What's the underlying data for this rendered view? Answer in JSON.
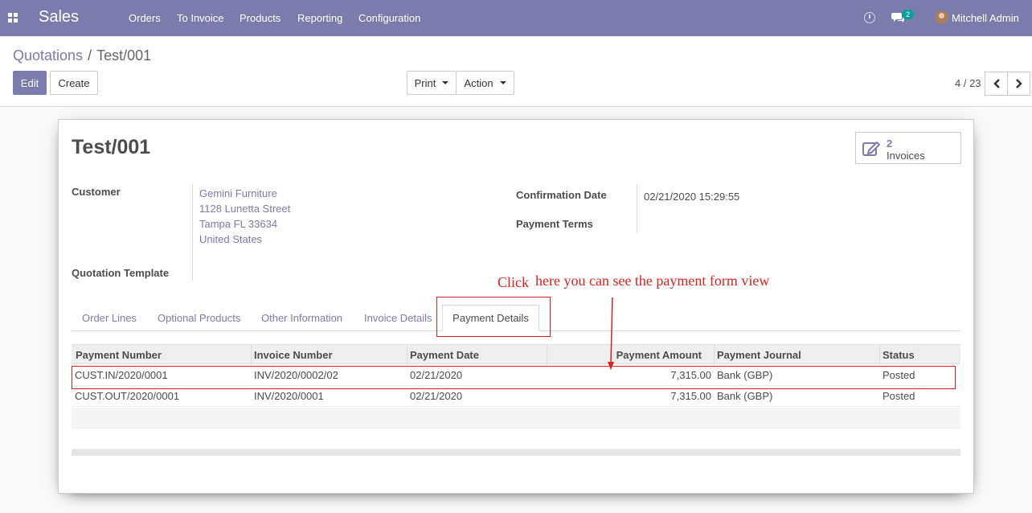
{
  "navbar": {
    "brand": "Sales",
    "menu": [
      "Orders",
      "To Invoice",
      "Products",
      "Reporting",
      "Configuration"
    ],
    "message_count": "2",
    "user": "Mitchell Admin"
  },
  "breadcrumb": {
    "parent": "Quotations",
    "separator": "/",
    "current": "Test/001"
  },
  "buttons": {
    "edit": "Edit",
    "create": "Create",
    "print": "Print",
    "action": "Action"
  },
  "pager": {
    "value": "4 / 23"
  },
  "form": {
    "title": "Test/001",
    "smart_button": {
      "count": "2",
      "label": "Invoices"
    },
    "customer_label": "Customer",
    "customer_address": [
      "Gemini Furniture",
      "1128 Lunetta Street",
      "Tampa FL 33634",
      "United States"
    ],
    "quotation_template_label": "Quotation Template",
    "confirmation_date_label": "Confirmation Date",
    "confirmation_date": "02/21/2020 15:29:55",
    "payment_terms_label": "Payment Terms"
  },
  "annotation": {
    "click": "Click",
    "text": "here you can see the payment form view"
  },
  "tabs": {
    "items": [
      "Order Lines",
      "Optional Products",
      "Other Information",
      "Invoice Details"
    ],
    "active": "Payment Details"
  },
  "payments": {
    "columns": [
      "Payment Number",
      "Invoice Number",
      "Payment Date",
      "Payment Amount",
      "Payment Journal",
      "Status"
    ],
    "rows": [
      [
        "CUST.IN/2020/0001",
        "INV/2020/0002/02",
        "02/21/2020",
        "7,315.00",
        "Bank (GBP)",
        "Posted"
      ],
      [
        "CUST.OUT/2020/0001",
        "INV/2020/0001",
        "02/21/2020",
        "7,315.00",
        "Bank (GBP)",
        "Posted"
      ]
    ]
  },
  "colors": {
    "brand": "#7c7bad",
    "annotation": "#e0201f",
    "badge": "#00a09d"
  }
}
